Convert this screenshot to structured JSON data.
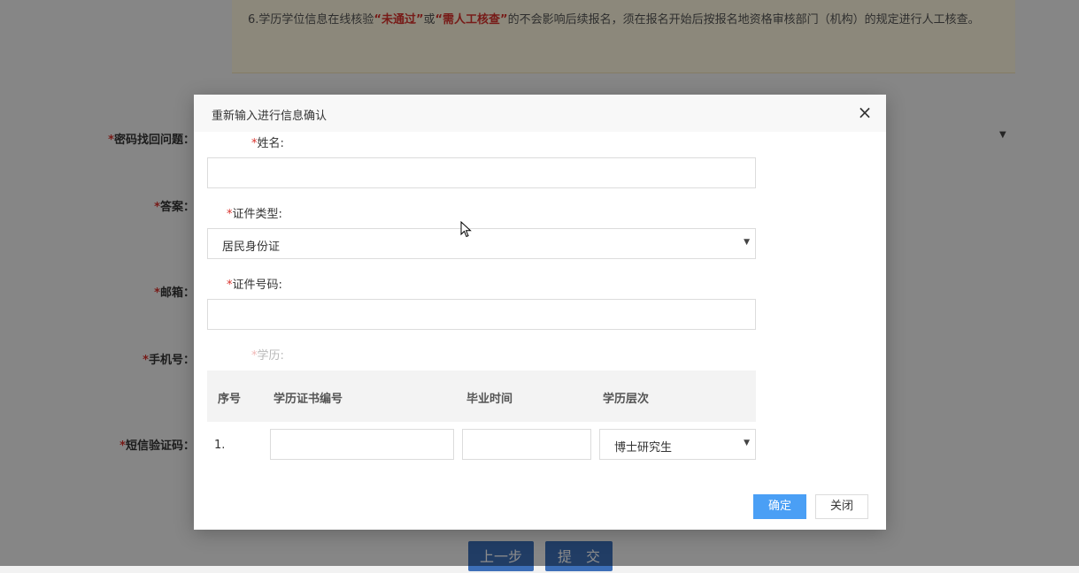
{
  "background": {
    "notice": {
      "prefix": "6.学历学位信息在线核验",
      "red1": "“未通过”",
      "mid": "或",
      "red2": "“需人工核查”",
      "suffix": "的不会影响后续报名，须在报名开始后按报名地资格审核部门（机构）的规定进行人工核查。"
    },
    "labels": {
      "security_question": "密码找回问题",
      "answer": "答案",
      "email": "邮箱",
      "phone": "手机号",
      "sms_code": "短信验证码"
    },
    "required_mark": "*",
    "colon": "：",
    "buttons": {
      "prev": "上一步",
      "submit": "提　交"
    }
  },
  "modal": {
    "title": "重新输入进行信息确认",
    "close_icon": "×",
    "required_mark": "*",
    "fields": {
      "name": {
        "label": "姓名:",
        "value": ""
      },
      "id_type": {
        "label": "证件类型:",
        "value": "居民身份证"
      },
      "id_number": {
        "label": "证件号码:",
        "value": ""
      },
      "education": {
        "label": "学历:"
      }
    },
    "table": {
      "headers": [
        "序号",
        "学历证书编号",
        "毕业时间",
        "学历层次"
      ],
      "rows": [
        {
          "index": "1.",
          "cert_no": "",
          "grad_date": "",
          "level": "博士研究生"
        }
      ]
    },
    "buttons": {
      "confirm": "确定",
      "close": "关闭"
    }
  },
  "colors": {
    "primary": "#4a9ff5",
    "required": "#d9322c",
    "notice_bg": "#fff8e0"
  }
}
